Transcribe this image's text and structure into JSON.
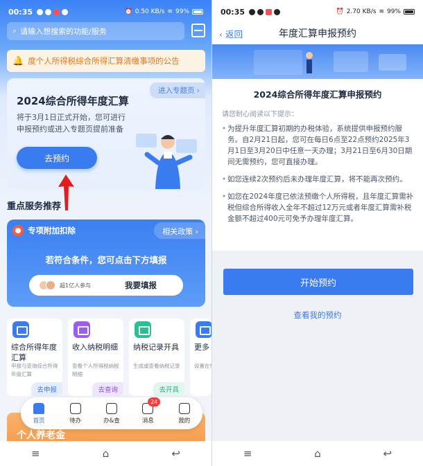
{
  "left": {
    "status": {
      "time": "00:35",
      "net": "0.50 KB/s",
      "battery": "99%"
    },
    "search": {
      "placeholder": "请输入想搜索的功能/服务"
    },
    "notice": "度个人所得税综合所得汇算清缴事项的公告",
    "banner": {
      "link": "进入专题页",
      "title": "2024综合所得年度汇算",
      "desc": "将于3月1日正式开始，您可进行申报预约或进入专题页提前准备",
      "button": "去预约"
    },
    "section_title": "重点服务推荐",
    "card": {
      "header": "专项附加扣除",
      "tag": "相关政策",
      "message": "若符合条件，您可点击下方填报",
      "users": "超1亿人参与",
      "fill": "我要填报"
    },
    "services": [
      {
        "name": "综合所得年度汇算",
        "desc": "申报与查询综合所得年度汇算",
        "action": "去申报",
        "color": "#3a7bef",
        "actcolor": "#e3edfd",
        "acttext": "#3a7bef"
      },
      {
        "name": "收入纳税明细",
        "desc": "查看个人所得税纳税明细",
        "action": "去查询",
        "color": "#9b5cf0",
        "actcolor": "#efe6fd",
        "acttext": "#8b4be6"
      },
      {
        "name": "纳税记录开具",
        "desc": "生成或查看纳税记录",
        "action": "去开具",
        "color": "#2bbf94",
        "actcolor": "#e1f6ef",
        "acttext": "#2baa85"
      },
      {
        "name": "更多",
        "desc": "设置在常用功",
        "action": "",
        "color": "#3a7bef",
        "actcolor": "#ffffff",
        "acttext": "#3a7bef"
      }
    ],
    "orange": {
      "title": "个人养老金",
      "subtitle": ""
    },
    "tabs": [
      {
        "label": "首页",
        "active": true,
        "badge": ""
      },
      {
        "label": "待办",
        "active": false,
        "badge": ""
      },
      {
        "label": "办&查",
        "active": false,
        "badge": ""
      },
      {
        "label": "消息",
        "active": false,
        "badge": "24"
      },
      {
        "label": "我的",
        "active": false,
        "badge": ""
      }
    ],
    "nav": [
      "≡",
      "⌂",
      "↩"
    ]
  },
  "right": {
    "status": {
      "time": "00:35",
      "net": "2.70 KB/s",
      "battery": "99%"
    },
    "back": "返回",
    "title": "年度汇算申报预约",
    "heading": "2024综合所得年度汇算申报预约",
    "intro": "请您耐心阅读以下提示：",
    "items": [
      "为提升年度汇算初期的办税体验，系统提供申报预约服务。自2月21日起，您可在每日6点至22点预约2025年3月1日至3月20日中任意一天办理；3月21日至6月30日期间无需预约，您可直接办理。",
      "如您连续2次预约后未办理年度汇算，将不能再次预约。",
      "如您在2024年度已依法预缴个人所得税，且年度汇算需补税但综合所得收入全年不超过12万元或者年度汇算需补税金额不超过400元可免予办理年度汇算。"
    ],
    "start": "开始预约",
    "my": "查看我的预约",
    "nav": [
      "≡",
      "⌂",
      "↩"
    ]
  },
  "colors": {
    "accent": "#3a7bef",
    "arrow": "#e11d1d"
  }
}
